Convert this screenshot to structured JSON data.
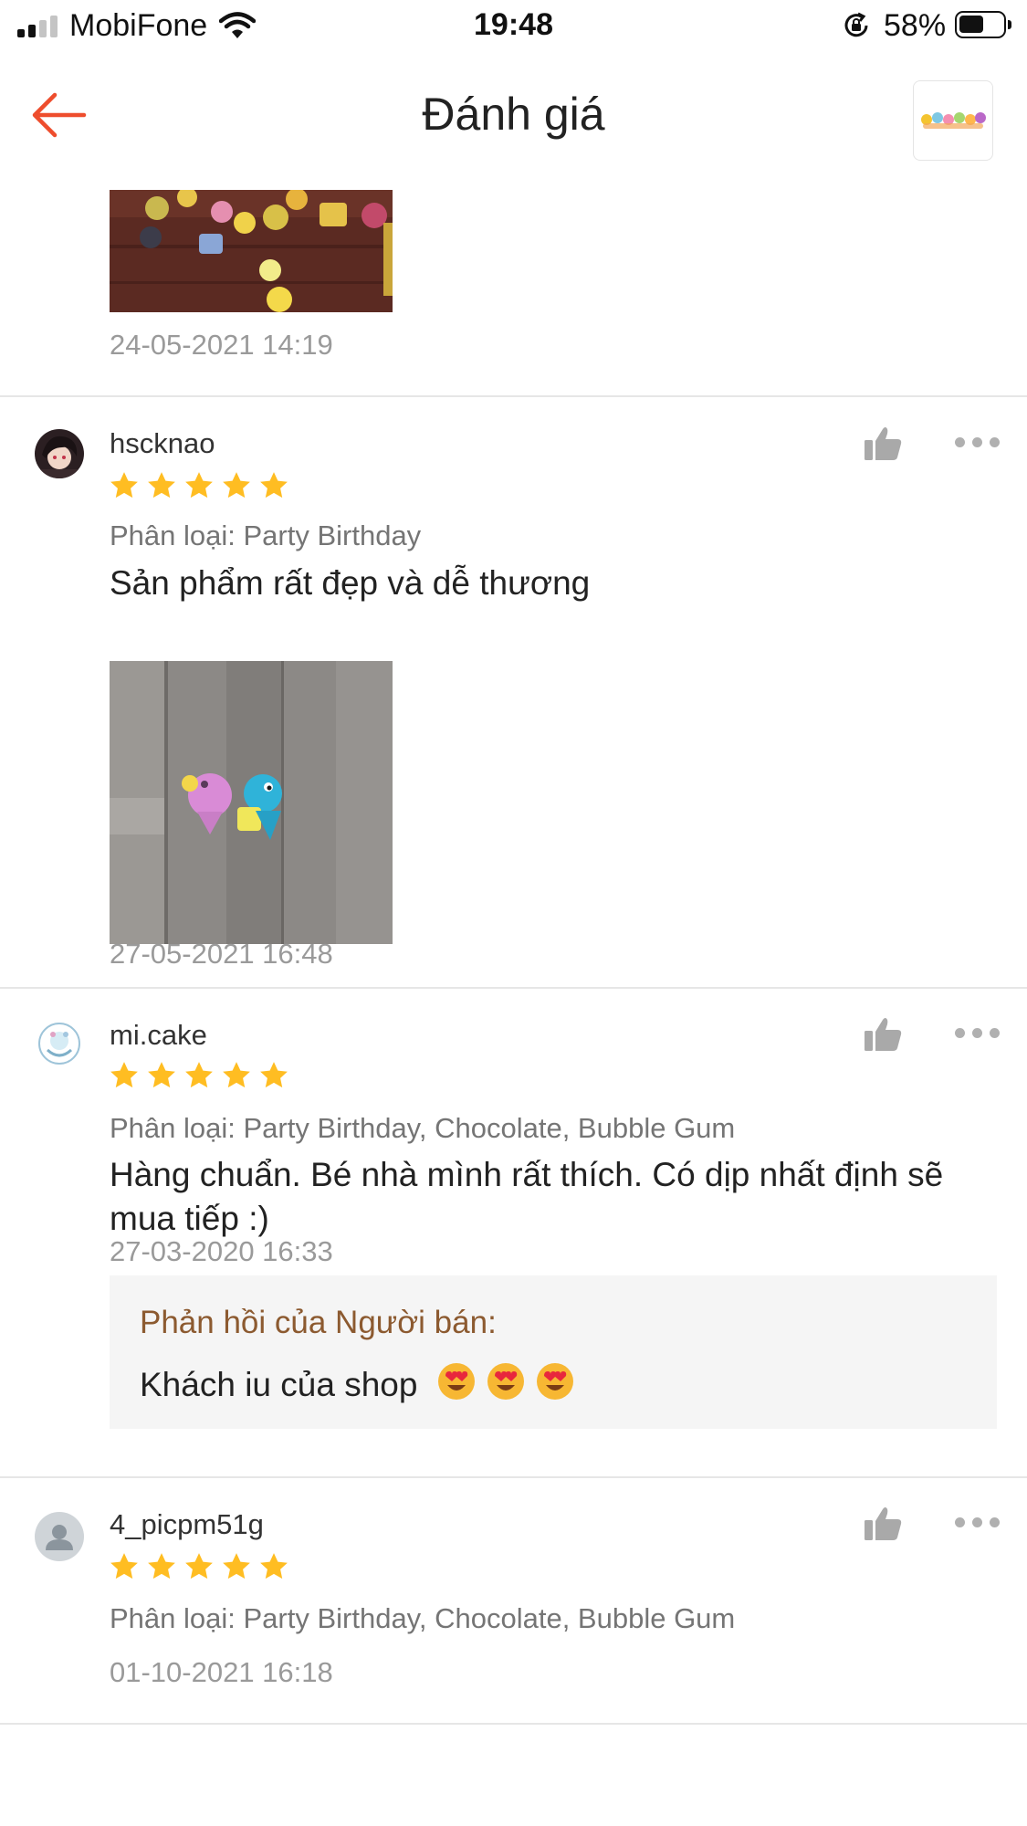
{
  "status_bar": {
    "carrier": "MobiFone",
    "time": "19:48",
    "battery_percent": "58%",
    "battery_level": 0.58
  },
  "header": {
    "title": "Đánh giá",
    "back_icon": "arrow-left-icon",
    "shop_icon": "shop-thumbnail-icon"
  },
  "colors": {
    "accent": "#ee4d2d",
    "star": "#ffbd22",
    "seller_reply_title": "#8c5a30",
    "variation_text": "#757575",
    "timestamp_text": "#9a9a9a"
  },
  "reviews": [
    {
      "timestamp": "24-05-2021 14:19"
    },
    {
      "username": "hscknao",
      "rating": 5,
      "variation": "Phân loại: Party Birthday",
      "comment": "Sản phẩm rất đẹp và dễ thương",
      "timestamp": "27-05-2021 16:48"
    },
    {
      "username": "mi.cake",
      "rating": 5,
      "variation": "Phân loại: Party Birthday, Chocolate, Bubble Gum",
      "comment": "Hàng chuẩn. Bé nhà mình rất thích. Có dịp nhất định sẽ mua tiếp :)",
      "timestamp": "27-03-2020 16:33",
      "seller_reply": {
        "title": "Phản hồi của Người bán:",
        "text": "Khách iu của shop"
      }
    },
    {
      "username": "4_picpm51g",
      "rating": 5,
      "variation": "Phân loại: Party Birthday, Chocolate, Bubble Gum",
      "timestamp": "01-10-2021 16:18"
    }
  ]
}
